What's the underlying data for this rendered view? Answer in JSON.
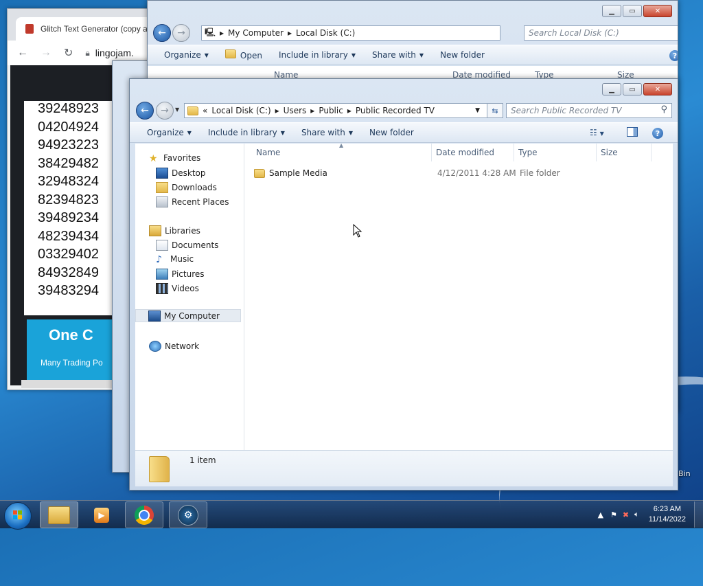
{
  "desktop": {
    "recycle_bin_label": "Bin"
  },
  "chrome": {
    "tab_title": "Glitch Text Generator (copy an",
    "url": "lingojam.",
    "numbers": [
      "39248923",
      "04204924",
      "94923223",
      "38429482",
      "32948324",
      "82394823",
      "39489234",
      "48239434",
      "03329402",
      "84932849",
      "39483294"
    ],
    "ad_big": "One C",
    "ad_small": "Many Trading Po"
  },
  "back_explorer": {
    "address": [
      "My Computer",
      "Local Disk (C:)"
    ],
    "search_placeholder": "Search Local Disk (C:)",
    "commands": [
      "Organize",
      "Open",
      "Include in library",
      "Share with",
      "New folder"
    ],
    "columns": [
      "Name",
      "Date modified",
      "Type",
      "Size"
    ],
    "nav_first": "Favorites"
  },
  "explorer": {
    "address_prefix": "«",
    "address": [
      "Local Disk (C:)",
      "Users",
      "Public",
      "Public Recorded TV"
    ],
    "search_placeholder": "Search Public Recorded TV",
    "commands": [
      "Organize",
      "Include in library",
      "Share with",
      "New folder"
    ],
    "columns": [
      "Name",
      "Date modified",
      "Type",
      "Size"
    ],
    "nav": {
      "favorites": "Favorites",
      "desktop": "Desktop",
      "downloads": "Downloads",
      "recent": "Recent Places",
      "libraries": "Libraries",
      "documents": "Documents",
      "music": "Music",
      "pictures": "Pictures",
      "videos": "Videos",
      "computer": "My Computer",
      "network": "Network"
    },
    "files": [
      {
        "name": "Sample Media",
        "date": "4/12/2011 4:28 AM",
        "type": "File folder",
        "size": ""
      }
    ],
    "status": "1 item"
  },
  "taskbar": {
    "time": "6:23 AM",
    "date": "11/14/2022"
  },
  "colors": {
    "accent": "#1b56a3",
    "titlebar": "#c7d6e9"
  }
}
